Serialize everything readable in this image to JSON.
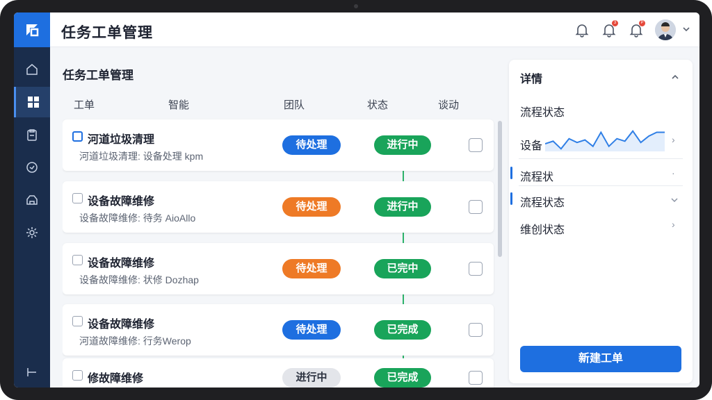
{
  "header": {
    "title": "任务工单管理",
    "notifications": [
      {
        "icon": "bell-icon",
        "badge": ""
      },
      {
        "icon": "bell-icon",
        "badge": "3"
      },
      {
        "icon": "bell-icon",
        "badge": "P"
      }
    ]
  },
  "sidebar": {
    "items": [
      {
        "icon": "home-icon"
      },
      {
        "icon": "grid-icon",
        "active": true
      },
      {
        "icon": "clipboard-icon"
      },
      {
        "icon": "clock-icon"
      },
      {
        "icon": "truck-icon"
      },
      {
        "icon": "gear-icon"
      }
    ],
    "collapse_icon": "collapse-icon"
  },
  "main": {
    "title": "任务工单管理",
    "columns": [
      "工单",
      "智能",
      "团队",
      "状态",
      "谈动"
    ],
    "rows": [
      {
        "title": "河道垃圾清理",
        "sub": "河道垃圾清理: 设备处理 kpm",
        "status": "待处理",
        "status_color": "blue",
        "progress": "进行中"
      },
      {
        "title": "设备故障维修",
        "sub": "设备故障维修: 待务 AioAllo",
        "status": "待处理",
        "status_color": "orange",
        "progress": "进行中"
      },
      {
        "title": "设备故障维修",
        "sub": "设备故障维修: 状修 Dozhap",
        "status": "待处理",
        "status_color": "orange",
        "progress": "已完中"
      },
      {
        "title": "设备故障维修",
        "sub": "河道故障维修: 行务Werop",
        "status": "待处理",
        "status_color": "blue",
        "progress": "已完成"
      },
      {
        "title": "修故障维修",
        "sub": "",
        "status": "进行中",
        "status_color": "gray",
        "progress": "已完成"
      }
    ]
  },
  "panel": {
    "title": "详情",
    "rows": [
      "流程状态",
      "设备",
      "流程状",
      "流程状态",
      "维创状态"
    ],
    "sparkline": [
      18,
      16,
      22,
      14,
      17,
      15,
      20,
      9,
      20,
      14,
      16,
      8,
      17,
      12,
      9,
      9
    ],
    "new_button": "新建工单"
  },
  "colors": {
    "primary": "#1e6fe0",
    "sidebar": "#1a2d4c",
    "orange": "#ee7a26",
    "green": "#19a45a"
  }
}
